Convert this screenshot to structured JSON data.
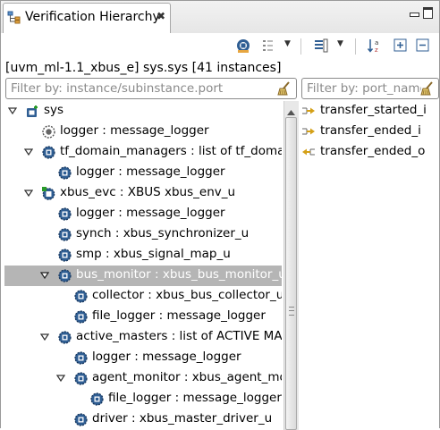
{
  "view": {
    "title": "Verification Hierarchy",
    "summary": "[uvm_ml-1.1_xbus_e] sys.sys [41 instances]"
  },
  "filters": {
    "instance_placeholder": "Filter by: instance/subinstance.port",
    "port_placeholder": "Filter by: port_name"
  },
  "tree": [
    {
      "label": "sys",
      "level": 0,
      "twisty": "expanded",
      "icon": "root-unit-icon",
      "selected": false
    },
    {
      "label": "logger : message_logger",
      "level": 1,
      "twisty": "none",
      "icon": "logger-unit-icon",
      "selected": false
    },
    {
      "label": "tf_domain_managers : list of tf_domai",
      "level": 1,
      "twisty": "expanded",
      "icon": "unit-icon",
      "selected": false
    },
    {
      "label": "logger : message_logger",
      "level": 2,
      "twisty": "none",
      "icon": "unit-icon",
      "selected": false
    },
    {
      "label": "xbus_evc : XBUS xbus_env_u",
      "level": 1,
      "twisty": "expanded",
      "icon": "env-unit-icon",
      "selected": false
    },
    {
      "label": "logger : message_logger",
      "level": 2,
      "twisty": "none",
      "icon": "unit-icon",
      "selected": false
    },
    {
      "label": "synch : xbus_synchronizer_u",
      "level": 2,
      "twisty": "none",
      "icon": "unit-icon",
      "selected": false
    },
    {
      "label": "smp : xbus_signal_map_u",
      "level": 2,
      "twisty": "none",
      "icon": "unit-icon",
      "selected": false
    },
    {
      "label": "bus_monitor : xbus_bus_monitor_u",
      "level": 2,
      "twisty": "expanded",
      "icon": "unit-icon",
      "selected": true
    },
    {
      "label": "collector : xbus_bus_collector_u",
      "level": 3,
      "twisty": "none",
      "icon": "unit-icon",
      "selected": false
    },
    {
      "label": "file_logger : message_logger",
      "level": 3,
      "twisty": "none",
      "icon": "unit-icon",
      "selected": false
    },
    {
      "label": "active_masters : list of ACTIVE MAS",
      "level": 2,
      "twisty": "expanded",
      "icon": "unit-icon",
      "selected": false
    },
    {
      "label": "logger : message_logger",
      "level": 3,
      "twisty": "none",
      "icon": "unit-icon",
      "selected": false
    },
    {
      "label": "agent_monitor : xbus_agent_mor",
      "level": 3,
      "twisty": "expanded",
      "icon": "unit-icon",
      "selected": false
    },
    {
      "label": "file_logger : message_logger",
      "level": 4,
      "twisty": "none",
      "icon": "unit-icon",
      "selected": false
    },
    {
      "label": "driver : xbus_master_driver_u",
      "level": 3,
      "twisty": "none",
      "icon": "unit-icon",
      "selected": false
    }
  ],
  "ports": [
    {
      "label": "transfer_started_i",
      "icon": "output-port-icon"
    },
    {
      "label": "transfer_ended_i",
      "icon": "output-port-icon"
    },
    {
      "label": "transfer_ended_o",
      "icon": "input-port-icon"
    }
  ],
  "colors": {
    "selection": "#b5b5b5",
    "unit_icon": "#2f5e93",
    "port_arrow": "#d4a017"
  }
}
